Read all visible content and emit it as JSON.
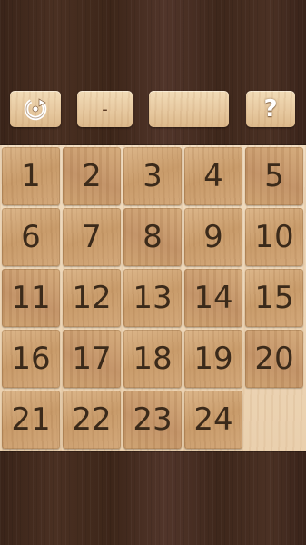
{
  "toolbar": {
    "restart_icon": "restart-icon",
    "moves_value": "-",
    "time_value": "",
    "help_label": "?"
  },
  "board": {
    "rows": 5,
    "cols": 5,
    "tiles": [
      "1",
      "2",
      "3",
      "4",
      "5",
      "6",
      "7",
      "8",
      "9",
      "10",
      "11",
      "12",
      "13",
      "14",
      "15",
      "16",
      "17",
      "18",
      "19",
      "20",
      "21",
      "22",
      "23",
      "24",
      ""
    ],
    "empty_index": 24
  },
  "colors": {
    "background_wood": "#3f281c",
    "board_light_wood": "#ecd3b2",
    "tile_wood": "#d2a878",
    "tile_text": "#3b2a1a",
    "button_wood": "#e8cba3"
  }
}
